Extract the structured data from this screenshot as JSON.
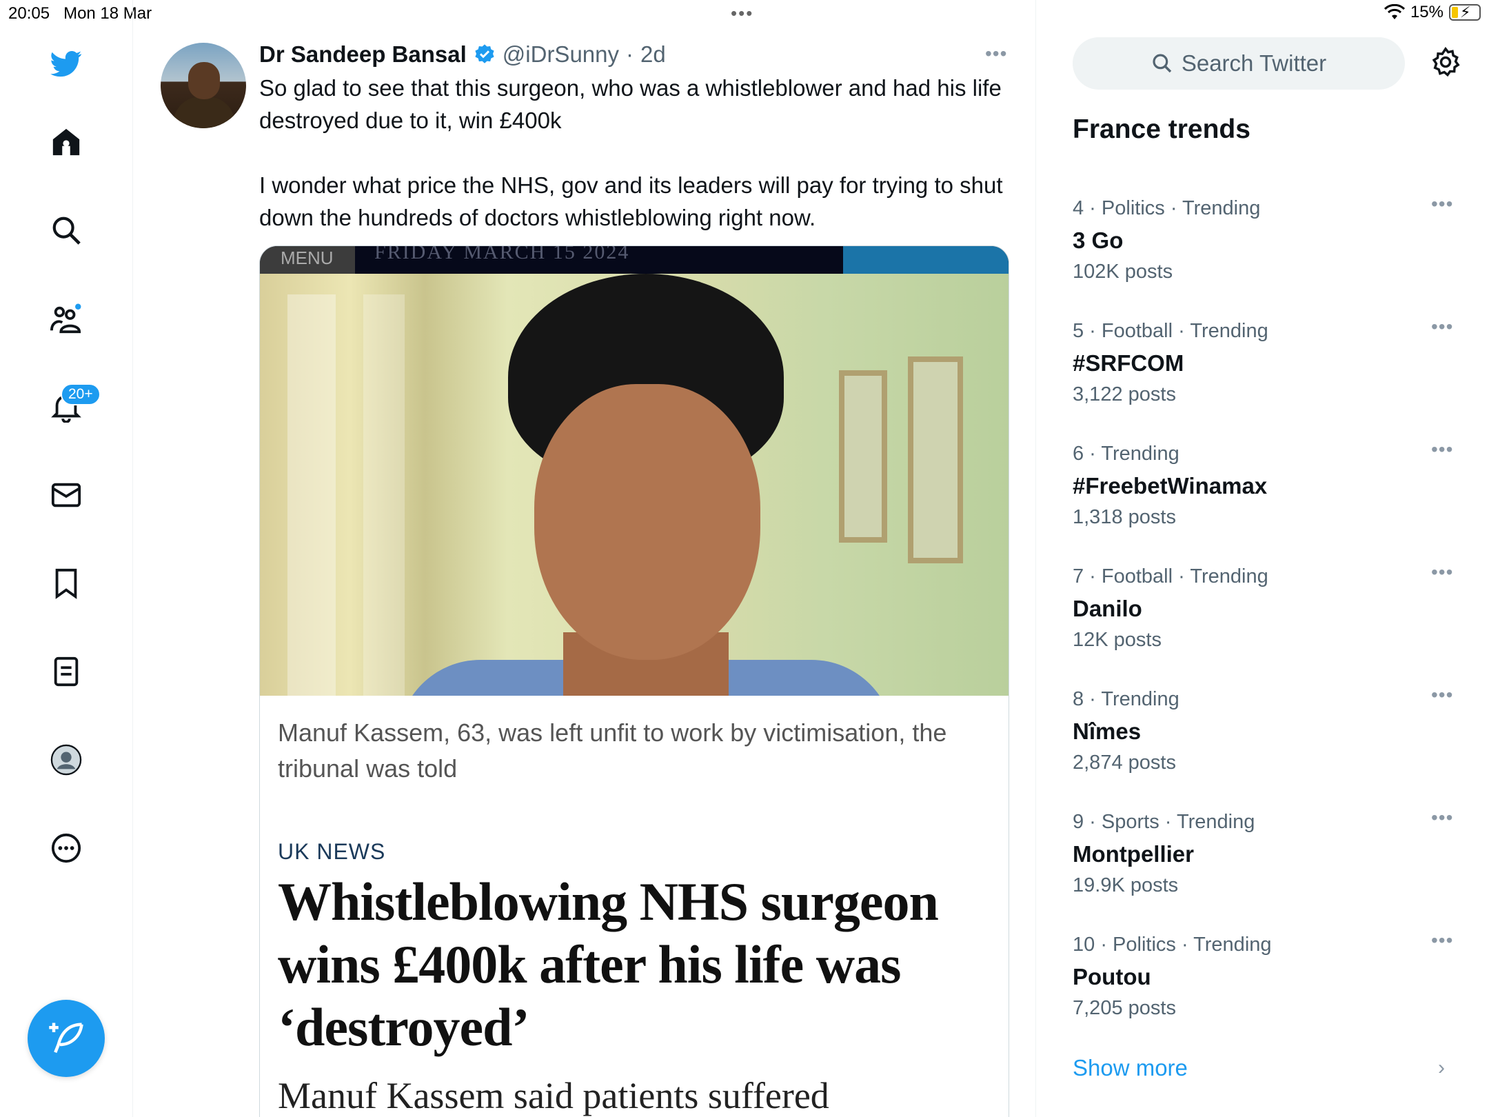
{
  "status_bar": {
    "time": "20:05",
    "date": "Mon 18 Mar",
    "battery": "15%",
    "dots": "•••"
  },
  "nav": {
    "notification_badge": "20+",
    "icons": [
      "twitter-logo-icon",
      "home-icon",
      "search-icon",
      "communities-icon",
      "notifications-icon",
      "messages-icon",
      "bookmarks-icon",
      "lists-icon",
      "profile-icon",
      "more-icon",
      "compose-icon"
    ]
  },
  "tweet": {
    "author": "Dr Sandeep Bansal",
    "handle": "@iDrSunny",
    "separator": "·",
    "age": "2d",
    "more": "•••",
    "text": "So glad to see that this surgeon, who was a whistleblower and had his life destroyed due to it, win £400k\n\nI wonder what price the NHS, gov and its leaders will pay for trying to shut down the hundreds of doctors whistleblowing right now."
  },
  "card": {
    "menu_label": "MENU",
    "date_label": "FRIDAY MARCH 15 2024",
    "caption": "Manuf Kassem, 63, was left unfit to work by victimisation, the tribunal was told",
    "section": "UK NEWS",
    "headline": "Whistleblowing NHS surgeon wins £400k after his life was ‘destroyed’",
    "standfirst": "Manuf Kassem said patients suffered"
  },
  "sidebar": {
    "search_placeholder": "Search Twitter",
    "trends_title": "France trends",
    "more": "•••",
    "trends": [
      {
        "meta": "4 · Politics · Trending",
        "name": "3 Go",
        "posts": "102K posts"
      },
      {
        "meta": "5 · Football · Trending",
        "name": "#SRFCOM",
        "posts": "3,122 posts"
      },
      {
        "meta": "6 · Trending",
        "name": "#FreebetWinamax",
        "posts": "1,318 posts"
      },
      {
        "meta": "7 · Football · Trending",
        "name": "Danilo",
        "posts": "12K posts"
      },
      {
        "meta": "8 · Trending",
        "name": "Nîmes",
        "posts": "2,874 posts"
      },
      {
        "meta": "9 · Sports · Trending",
        "name": "Montpellier",
        "posts": "19.9K posts"
      },
      {
        "meta": "10 · Politics · Trending",
        "name": "Poutou",
        "posts": "7,205 posts"
      }
    ],
    "show_more": "Show more",
    "chevron": "›"
  },
  "colors": {
    "accent": "#1d9bf0",
    "text": "#0f1419",
    "muted": "#536471"
  }
}
